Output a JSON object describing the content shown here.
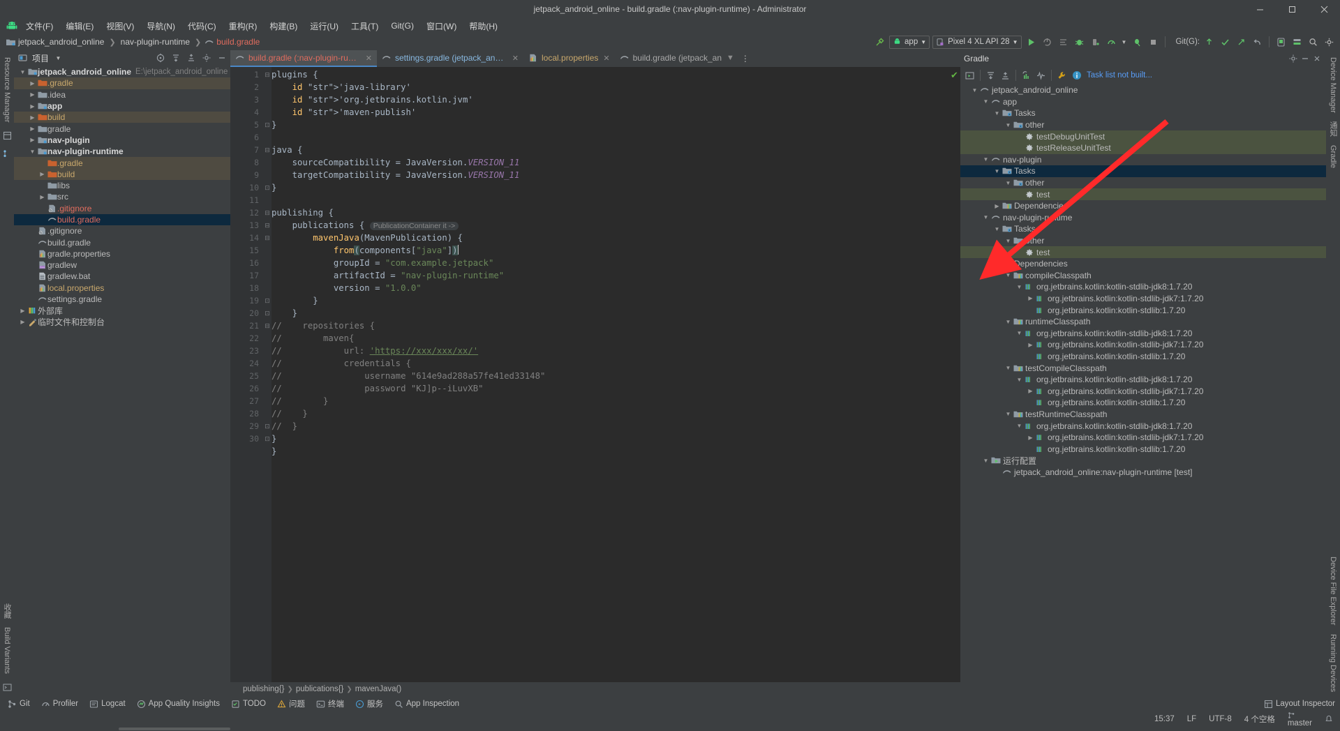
{
  "window": {
    "title": "jetpack_android_online - build.gradle (:nav-plugin-runtime) - Administrator",
    "minimize": "─",
    "maximize": "☐",
    "close": "✕"
  },
  "menu": {
    "items": [
      {
        "label": "文件(F)"
      },
      {
        "label": "编辑(E)"
      },
      {
        "label": "视图(V)"
      },
      {
        "label": "导航(N)"
      },
      {
        "label": "代码(C)"
      },
      {
        "label": "重构(R)"
      },
      {
        "label": "构建(B)"
      },
      {
        "label": "运行(U)"
      },
      {
        "label": "工具(T)"
      },
      {
        "label": "Git(G)"
      },
      {
        "label": "窗口(W)"
      },
      {
        "label": "帮助(H)"
      }
    ]
  },
  "navbar": {
    "breadcrumb": [
      "jetpack_android_online",
      "nav-plugin-runtime",
      "build.gradle"
    ],
    "module_selector": "app",
    "device_selector": "Pixel 4 XL API 28",
    "git_label": "Git(G):"
  },
  "project_panel": {
    "title": "项目",
    "tree": [
      {
        "indent": 0,
        "arrow": "v",
        "icon": "module-icon",
        "label": "jetpack_android_online",
        "style": "bold",
        "path": "E:\\jetpack_android_online",
        "state": "normal"
      },
      {
        "indent": 1,
        "arrow": ">",
        "icon": "folder-orange-icon",
        "label": ".gradle",
        "style": "orange",
        "state": "highlight"
      },
      {
        "indent": 1,
        "arrow": ">",
        "icon": "folder-icon",
        "label": ".idea",
        "style": "normal",
        "state": "normal"
      },
      {
        "indent": 1,
        "arrow": ">",
        "icon": "module-icon",
        "label": "app",
        "style": "bold",
        "state": "normal"
      },
      {
        "indent": 1,
        "arrow": ">",
        "icon": "folder-orange-icon",
        "label": "build",
        "style": "orange",
        "state": "highlight"
      },
      {
        "indent": 1,
        "arrow": ">",
        "icon": "folder-icon",
        "label": "gradle",
        "style": "normal",
        "state": "normal"
      },
      {
        "indent": 1,
        "arrow": ">",
        "icon": "module-icon",
        "label": "nav-plugin",
        "style": "bold",
        "state": "normal"
      },
      {
        "indent": 1,
        "arrow": "v",
        "icon": "module-icon",
        "label": "nav-plugin-runtime",
        "style": "bold",
        "state": "normal"
      },
      {
        "indent": 2,
        "arrow": "",
        "icon": "folder-orange-icon",
        "label": ".gradle",
        "style": "orange",
        "state": "highlight"
      },
      {
        "indent": 2,
        "arrow": ">",
        "icon": "folder-orange-icon",
        "label": "build",
        "style": "orange",
        "state": "highlight"
      },
      {
        "indent": 2,
        "arrow": "",
        "icon": "folder-icon",
        "label": "libs",
        "style": "normal",
        "state": "normal"
      },
      {
        "indent": 2,
        "arrow": ">",
        "icon": "folder-icon",
        "label": "src",
        "style": "normal",
        "state": "normal"
      },
      {
        "indent": 2,
        "arrow": "",
        "icon": "gitignore-icon",
        "label": ".gitignore",
        "style": "red",
        "state": "normal"
      },
      {
        "indent": 2,
        "arrow": "",
        "icon": "gradle-icon",
        "label": "build.gradle",
        "style": "red",
        "state": "selected"
      },
      {
        "indent": 1,
        "arrow": "",
        "icon": "gitignore-icon",
        "label": ".gitignore",
        "style": "normal",
        "state": "normal"
      },
      {
        "indent": 1,
        "arrow": "",
        "icon": "gradle-icon",
        "label": "build.gradle",
        "style": "normal",
        "state": "normal"
      },
      {
        "indent": 1,
        "arrow": "",
        "icon": "properties-icon",
        "label": "gradle.properties",
        "style": "normal",
        "state": "normal"
      },
      {
        "indent": 1,
        "arrow": "",
        "icon": "script-icon",
        "label": "gradlew",
        "style": "normal",
        "state": "normal"
      },
      {
        "indent": 1,
        "arrow": "",
        "icon": "bat-icon",
        "label": "gradlew.bat",
        "style": "normal",
        "state": "normal"
      },
      {
        "indent": 1,
        "arrow": "",
        "icon": "properties-icon",
        "label": "local.properties",
        "style": "orange",
        "state": "normal"
      },
      {
        "indent": 1,
        "arrow": "",
        "icon": "gradle-icon",
        "label": "settings.gradle",
        "style": "normal",
        "state": "normal"
      },
      {
        "indent": 0,
        "arrow": ">",
        "icon": "library-icon",
        "label": "外部库",
        "style": "normal",
        "state": "normal"
      },
      {
        "indent": 0,
        "arrow": ">",
        "icon": "scratch-icon",
        "label": "临时文件和控制台",
        "style": "normal",
        "state": "normal"
      }
    ]
  },
  "editor": {
    "tabs": [
      {
        "label": "build.gradle (:nav-plugin-runtime)",
        "icon": "gradle-icon",
        "active": true,
        "color": "red",
        "closable": true
      },
      {
        "label": "settings.gradle (jetpack_android_online)",
        "icon": "gradle-icon",
        "active": false,
        "color": "blue",
        "closable": true
      },
      {
        "label": "local.properties",
        "icon": "properties-icon",
        "active": false,
        "color": "orange",
        "closable": true
      },
      {
        "label": "build.gradle (jetpack_an",
        "icon": "gradle-icon",
        "active": false,
        "color": "normal",
        "closable": false
      }
    ],
    "line_count": 30,
    "inlay_hint": "PublicationContainer it ->",
    "code_lines": [
      "plugins {",
      "    id 'java-library'",
      "    id 'org.jetbrains.kotlin.jvm'",
      "    id 'maven-publish'",
      "}",
      "",
      "java {",
      "    sourceCompatibility = JavaVersion.VERSION_11",
      "    targetCompatibility = JavaVersion.VERSION_11",
      "}",
      "",
      "publishing {",
      "    publications {",
      "        mavenJava(MavenPublication) {",
      "            from(components[\"java\"])",
      "            groupId = \"com.example.jetpack\"",
      "            artifactId = \"nav-plugin-runtime\"",
      "            version = \"1.0.0\"",
      "        }",
      "    }",
      "//    repositories {",
      "//        maven{",
      "//            url: 'https://xxx/xxx/xx/'",
      "//            credentials {",
      "//                username \"614e9ad288a57fe41ed33148\"",
      "//                password \"KJ]p--iLuvXB\"",
      "//        }",
      "//    }",
      "//  }",
      "}"
    ],
    "breadcrumbs": [
      "publishing{}",
      "publications{}",
      "mavenJava()"
    ]
  },
  "gradle_panel": {
    "title": "Gradle",
    "notice": "Task list not built...",
    "tree": [
      {
        "indent": 0,
        "arrow": "v",
        "icon": "gradle-icon",
        "label": "jetpack_android_online",
        "state": "normal"
      },
      {
        "indent": 1,
        "arrow": "v",
        "icon": "gradle-icon",
        "label": "app",
        "state": "normal"
      },
      {
        "indent": 2,
        "arrow": "v",
        "icon": "tasks-icon",
        "label": "Tasks",
        "state": "normal"
      },
      {
        "indent": 3,
        "arrow": "v",
        "icon": "tasks-icon",
        "label": "other",
        "state": "normal"
      },
      {
        "indent": 4,
        "arrow": "",
        "icon": "task-gear-icon",
        "label": "testDebugUnitTest",
        "state": "green"
      },
      {
        "indent": 4,
        "arrow": "",
        "icon": "task-gear-icon",
        "label": "testReleaseUnitTest",
        "state": "green"
      },
      {
        "indent": 1,
        "arrow": "v",
        "icon": "gradle-icon",
        "label": "nav-plugin",
        "state": "normal"
      },
      {
        "indent": 2,
        "arrow": "v",
        "icon": "tasks-icon",
        "label": "Tasks",
        "state": "selected"
      },
      {
        "indent": 3,
        "arrow": "v",
        "icon": "tasks-icon",
        "label": "other",
        "state": "normal"
      },
      {
        "indent": 4,
        "arrow": "",
        "icon": "task-gear-icon",
        "label": "test",
        "state": "green"
      },
      {
        "indent": 2,
        "arrow": ">",
        "icon": "deps-icon",
        "label": "Dependencies",
        "state": "normal"
      },
      {
        "indent": 1,
        "arrow": "v",
        "icon": "gradle-icon",
        "label": "nav-plugin-runtime",
        "state": "normal"
      },
      {
        "indent": 2,
        "arrow": "v",
        "icon": "tasks-icon",
        "label": "Tasks",
        "state": "normal"
      },
      {
        "indent": 3,
        "arrow": "v",
        "icon": "tasks-icon",
        "label": "other",
        "state": "normal"
      },
      {
        "indent": 4,
        "arrow": "",
        "icon": "task-gear-icon",
        "label": "test",
        "state": "green"
      },
      {
        "indent": 2,
        "arrow": "v",
        "icon": "deps-icon",
        "label": "Dependencies",
        "state": "normal"
      },
      {
        "indent": 3,
        "arrow": "v",
        "icon": "deps-icon",
        "label": "compileClasspath",
        "state": "normal"
      },
      {
        "indent": 4,
        "arrow": "v",
        "icon": "lib-icon",
        "label": "org.jetbrains.kotlin:kotlin-stdlib-jdk8:1.7.20",
        "state": "normal"
      },
      {
        "indent": 5,
        "arrow": ">",
        "icon": "lib-icon",
        "label": "org.jetbrains.kotlin:kotlin-stdlib-jdk7:1.7.20",
        "state": "normal"
      },
      {
        "indent": 5,
        "arrow": "",
        "icon": "lib-icon",
        "label": "org.jetbrains.kotlin:kotlin-stdlib:1.7.20",
        "state": "normal"
      },
      {
        "indent": 3,
        "arrow": "v",
        "icon": "deps-icon",
        "label": "runtimeClasspath",
        "state": "normal"
      },
      {
        "indent": 4,
        "arrow": "v",
        "icon": "lib-icon",
        "label": "org.jetbrains.kotlin:kotlin-stdlib-jdk8:1.7.20",
        "state": "normal"
      },
      {
        "indent": 5,
        "arrow": ">",
        "icon": "lib-icon",
        "label": "org.jetbrains.kotlin:kotlin-stdlib-jdk7:1.7.20",
        "state": "normal"
      },
      {
        "indent": 5,
        "arrow": "",
        "icon": "lib-icon",
        "label": "org.jetbrains.kotlin:kotlin-stdlib:1.7.20",
        "state": "normal"
      },
      {
        "indent": 3,
        "arrow": "v",
        "icon": "deps-icon",
        "label": "testCompileClasspath",
        "state": "normal"
      },
      {
        "indent": 4,
        "arrow": "v",
        "icon": "lib-icon",
        "label": "org.jetbrains.kotlin:kotlin-stdlib-jdk8:1.7.20",
        "state": "normal"
      },
      {
        "indent": 5,
        "arrow": ">",
        "icon": "lib-icon",
        "label": "org.jetbrains.kotlin:kotlin-stdlib-jdk7:1.7.20",
        "state": "normal"
      },
      {
        "indent": 5,
        "arrow": "",
        "icon": "lib-icon",
        "label": "org.jetbrains.kotlin:kotlin-stdlib:1.7.20",
        "state": "normal"
      },
      {
        "indent": 3,
        "arrow": "v",
        "icon": "deps-icon",
        "label": "testRuntimeClasspath",
        "state": "normal"
      },
      {
        "indent": 4,
        "arrow": "v",
        "icon": "lib-icon",
        "label": "org.jetbrains.kotlin:kotlin-stdlib-jdk8:1.7.20",
        "state": "normal"
      },
      {
        "indent": 5,
        "arrow": ">",
        "icon": "lib-icon",
        "label": "org.jetbrains.kotlin:kotlin-stdlib-jdk7:1.7.20",
        "state": "normal"
      },
      {
        "indent": 5,
        "arrow": "",
        "icon": "lib-icon",
        "label": "org.jetbrains.kotlin:kotlin-stdlib:1.7.20",
        "state": "normal"
      },
      {
        "indent": 1,
        "arrow": "v",
        "icon": "runconfig-icon",
        "label": "运行配置",
        "state": "normal"
      },
      {
        "indent": 2,
        "arrow": "",
        "icon": "runconfig-item-icon",
        "label": "jetpack_android_online:nav-plugin-runtime [test]",
        "state": "normal"
      }
    ]
  },
  "left_strip": {
    "top_tab": "Resource Manager",
    "bottom_tabs": [
      "收藏",
      "Build Variants"
    ]
  },
  "right_strip": {
    "tabs": [
      "Device Manager",
      "通知",
      "Gradle",
      "Device File Explorer",
      "Running Devices"
    ]
  },
  "bottom_bar": {
    "items": [
      {
        "label": "Git",
        "icon": "git-icon"
      },
      {
        "label": "Profiler",
        "icon": "profiler-icon"
      },
      {
        "label": "Logcat",
        "icon": "logcat-icon"
      },
      {
        "label": "App Quality Insights",
        "icon": "insights-icon"
      },
      {
        "label": "TODO",
        "icon": "todo-icon"
      },
      {
        "label": "问题",
        "icon": "problems-icon"
      },
      {
        "label": "终端",
        "icon": "terminal-icon"
      },
      {
        "label": "服务",
        "icon": "services-icon"
      },
      {
        "label": "App Inspection",
        "icon": "inspection-icon"
      }
    ],
    "layout_inspector": "Layout Inspector"
  },
  "status_bar": {
    "time": "15:37",
    "line_ending": "LF",
    "encoding": "UTF-8",
    "indent": "4 个空格",
    "branch": "master"
  },
  "annotation": {
    "arrow_color": "#ff2a2a"
  }
}
